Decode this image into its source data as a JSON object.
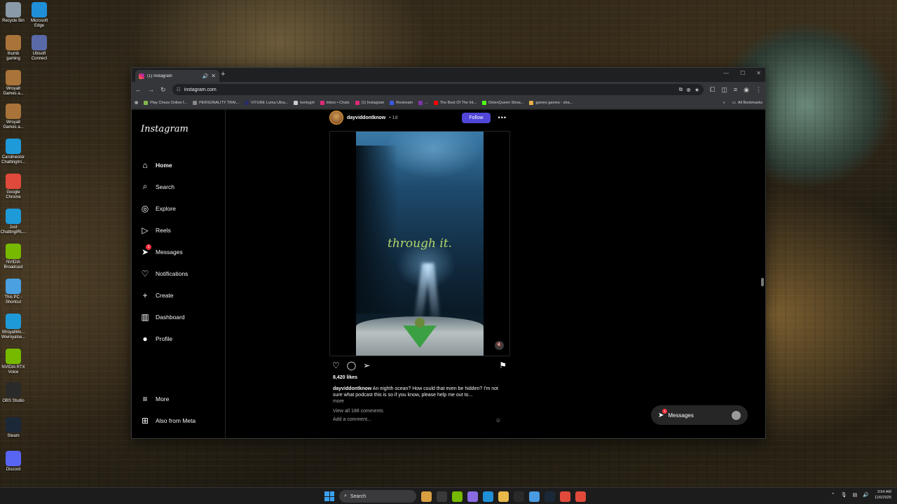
{
  "desktop": {
    "icons": [
      {
        "label": "Recycle Bin",
        "color": "#8a9aa8"
      },
      {
        "label": "Microsoft Edge",
        "color": "#1f8fd8"
      },
      {
        "label": "thumb gaming",
        "color": "#a8743a"
      },
      {
        "label": "Ubisoft Connect",
        "color": "#5a6aa8"
      },
      {
        "label": "Wroyalt Games a...",
        "color": "#a8743a"
      },
      {
        "label": "Wroyalt Games a...",
        "color": "#a8743a"
      },
      {
        "label": "Carolinestor ChattingInl...",
        "color": "#1f9ad8"
      },
      {
        "label": "Google Chrome",
        "color": "#e04a3a"
      },
      {
        "label": "Just ChattingIRL...",
        "color": "#1f9ad8"
      },
      {
        "label": "NVIDIA Broadcast",
        "color": "#76b900"
      },
      {
        "label": "This PC - Shortcut",
        "color": "#4aa0e0"
      },
      {
        "label": "WroyalWo... Wwroyalse...",
        "color": "#1f9ad8"
      },
      {
        "label": "NVIDIA RTX Voice",
        "color": "#76b900"
      },
      {
        "label": "OBS Studio",
        "color": "#2a2a2a"
      },
      {
        "label": "Steam",
        "color": "#1b2838"
      },
      {
        "label": "Discord",
        "color": "#5865f2"
      }
    ]
  },
  "browser": {
    "tab_title": "(1) Instagram",
    "new_tab": "+",
    "url": "instagram.com",
    "bookmarks": [
      {
        "label": "Play Chess Online f...",
        "color": "#81b64c"
      },
      {
        "label": "PERSONALITY TRAI...",
        "color": "#888888"
      },
      {
        "label": "VITURE Luma Ultra...",
        "color": "#2a2a6a"
      },
      {
        "label": "kentygirl",
        "color": "#cccccc"
      },
      {
        "label": "Inbox • Chats",
        "color": "#dd2a7b"
      },
      {
        "label": "(1) Instagram",
        "color": "#dd2a7b"
      },
      {
        "label": "Restream",
        "color": "#3a5ae8"
      },
      {
        "label": "...",
        "color": "#8134af"
      },
      {
        "label": "The Best Of The Int...",
        "color": "#ff0000"
      },
      {
        "label": "DelenQueen Strea...",
        "color": "#53fc18"
      },
      {
        "label": "games games - sha...",
        "color": "#e8b04a"
      }
    ],
    "all_bookmarks": "All Bookmarks"
  },
  "sidebar": {
    "logo": "Instagram",
    "items": [
      {
        "label": "Home",
        "icon": "⌂"
      },
      {
        "label": "Search",
        "icon": "⌕"
      },
      {
        "label": "Explore",
        "icon": "◎"
      },
      {
        "label": "Reels",
        "icon": "▷"
      },
      {
        "label": "Messages",
        "icon": "➤",
        "badge": "1"
      },
      {
        "label": "Notifications",
        "icon": "♡"
      },
      {
        "label": "Create",
        "icon": "+"
      },
      {
        "label": "Dashboard",
        "icon": "▥"
      },
      {
        "label": "Profile",
        "icon": "●"
      }
    ],
    "more": {
      "label": "More",
      "icon": "≡"
    },
    "also_from_meta": {
      "label": "Also from Meta",
      "icon": "⊞"
    }
  },
  "post": {
    "username": "dayviddontknow",
    "time": "• 1d",
    "follow_label": "Follow",
    "more_icon": "•••",
    "overlay_text": "through it.",
    "mute_icon": "🔇",
    "likes": "8,420 likes",
    "caption_user": "dayviddontknow",
    "caption_text": " An eighth ocean? How could that even be hidden? I'm not sure what podcast this is so if you know, please help me out to...",
    "more_link": "more",
    "view_comments": "View all 188 comments",
    "add_comment": "Add a comment...",
    "emoji_icon": "☺"
  },
  "messages_pill": {
    "label": "Messages",
    "badge": "1"
  },
  "taskbar": {
    "search_label": "Search",
    "time": "3:54 AM",
    "date": "11/6/2025",
    "apps": [
      "#d8a040",
      "#3a3a3a",
      "#76b900",
      "#8a6ae0",
      "#1f8fd8",
      "#e8b84a",
      "#2a2a2a",
      "#4a9ae0",
      "#1b2838",
      "#e04a3a",
      "#e04a3a"
    ]
  }
}
